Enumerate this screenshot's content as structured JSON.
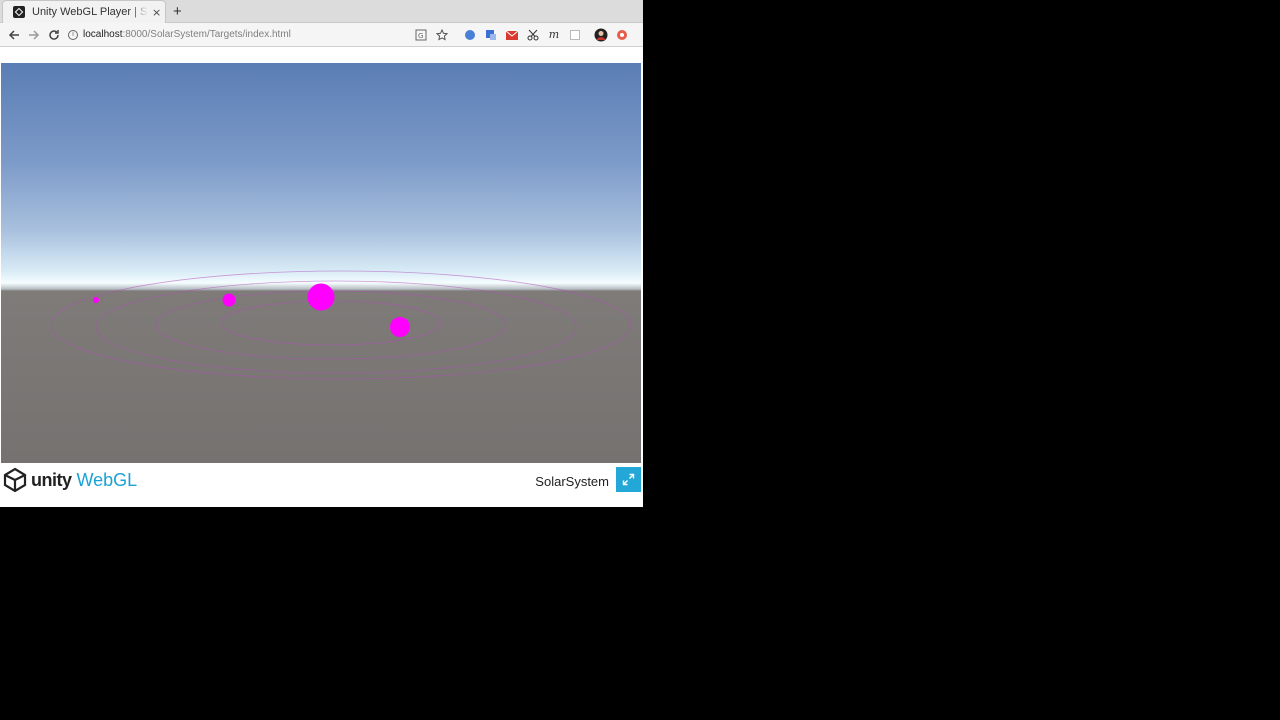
{
  "browser": {
    "tab": {
      "title": "Unity WebGL Player | SolarSystem"
    },
    "new_tab_label": "+",
    "close_glyph": "×",
    "toolbar": {
      "url_host": "localhost",
      "url_rest": ":8000/SolarSystem/Targets/index.html",
      "info_glyph": "i"
    },
    "extension_icons": [
      "translate-icon",
      "bookmark-star-icon",
      "extension-blue-icon",
      "extension-translate-icon",
      "gmail-icon",
      "scissors-icon",
      "m-extension-icon",
      "blank-extension-icon",
      "profile-avatar-icon",
      "red-extension-icon"
    ],
    "ext_m_label": "m"
  },
  "unity": {
    "footer": {
      "logo_unity": "unity",
      "logo_webgl": "WebGL",
      "title": "SolarSystem"
    },
    "scene_colors": {
      "planet": "#ff00ff",
      "orbit": "#b34dba",
      "ground": "#767371"
    }
  },
  "colors": {
    "accent": "#22a7d6",
    "page_background": "#000000"
  }
}
